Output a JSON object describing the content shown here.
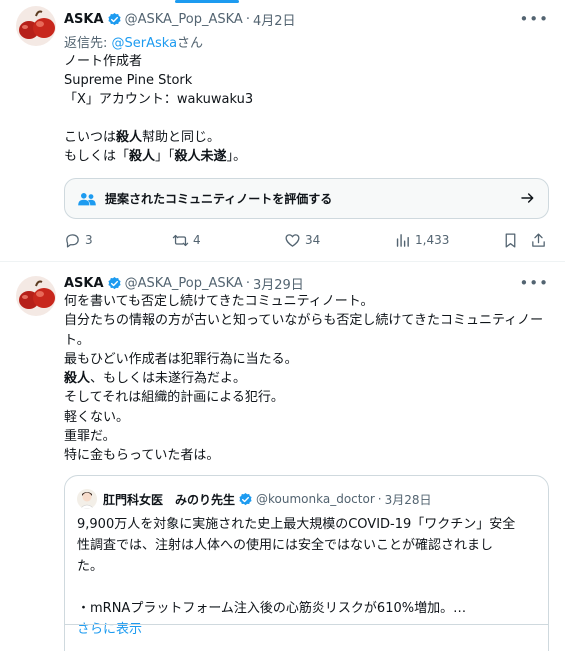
{
  "colors": {
    "accent": "#1d9bf0",
    "text": "#0f1419",
    "muted": "#536471",
    "border": "#cfd9de"
  },
  "tweets": [
    {
      "author": {
        "name": "ASKA",
        "handle": "@ASKA_Pop_ASKA",
        "verified": true
      },
      "date": "4月2日",
      "more_icon": "more-dots-icon",
      "reply_to": {
        "prefix": "返信先: ",
        "mention": "@SerAska",
        "suffix": "さん"
      },
      "lines": [
        "ノート作成者",
        "Supreme Pine Stork",
        "「X」アカウント：wakuwaku3",
        "",
        "こいつは殺人幇助と同じ。",
        "もしくは「殺人」「殺人未遂」。"
      ],
      "community_note": {
        "label": "提案されたコミュニティノートを評価する",
        "icon": "people-icon",
        "arrow_icon": "arrow-right-icon"
      },
      "actions": {
        "replies": "3",
        "retweets": "4",
        "likes": "34",
        "views": "1,433"
      }
    },
    {
      "author": {
        "name": "ASKA",
        "handle": "@ASKA_Pop_ASKA",
        "verified": true
      },
      "date": "3月29日",
      "more_icon": "more-dots-icon",
      "lines": [
        "何を書いても否定し続けてきたコミュニティノート。",
        "自分たちの情報の方が古いと知っていながらも否定し続けてきたコミュニティノート。",
        "最もひどい作成者は犯罪行為に当たる。",
        "殺人、もしくは未遂行為だよ。",
        "そしてそれは組織的計画による犯行。",
        "軽くない。",
        "重罪だ。",
        "特に金もらっていた者は。"
      ],
      "quote": {
        "author": {
          "name": "肛門科女医　みのり先生",
          "handle": "@koumonka_doctor",
          "verified": true
        },
        "date": "3月28日",
        "lines": [
          "9,900万人を対象に実施された史上最大規模のCOVID-19「ワクチン」安全",
          "性調査では、注射は人体への使用には安全ではないことが確認されまし",
          "た。",
          "",
          "・mRNAプラットフォーム注入後の心筋炎リスクが610%増加。…"
        ],
        "show_more": "さらに表示"
      }
    }
  ],
  "ui": {
    "dot": "·"
  }
}
